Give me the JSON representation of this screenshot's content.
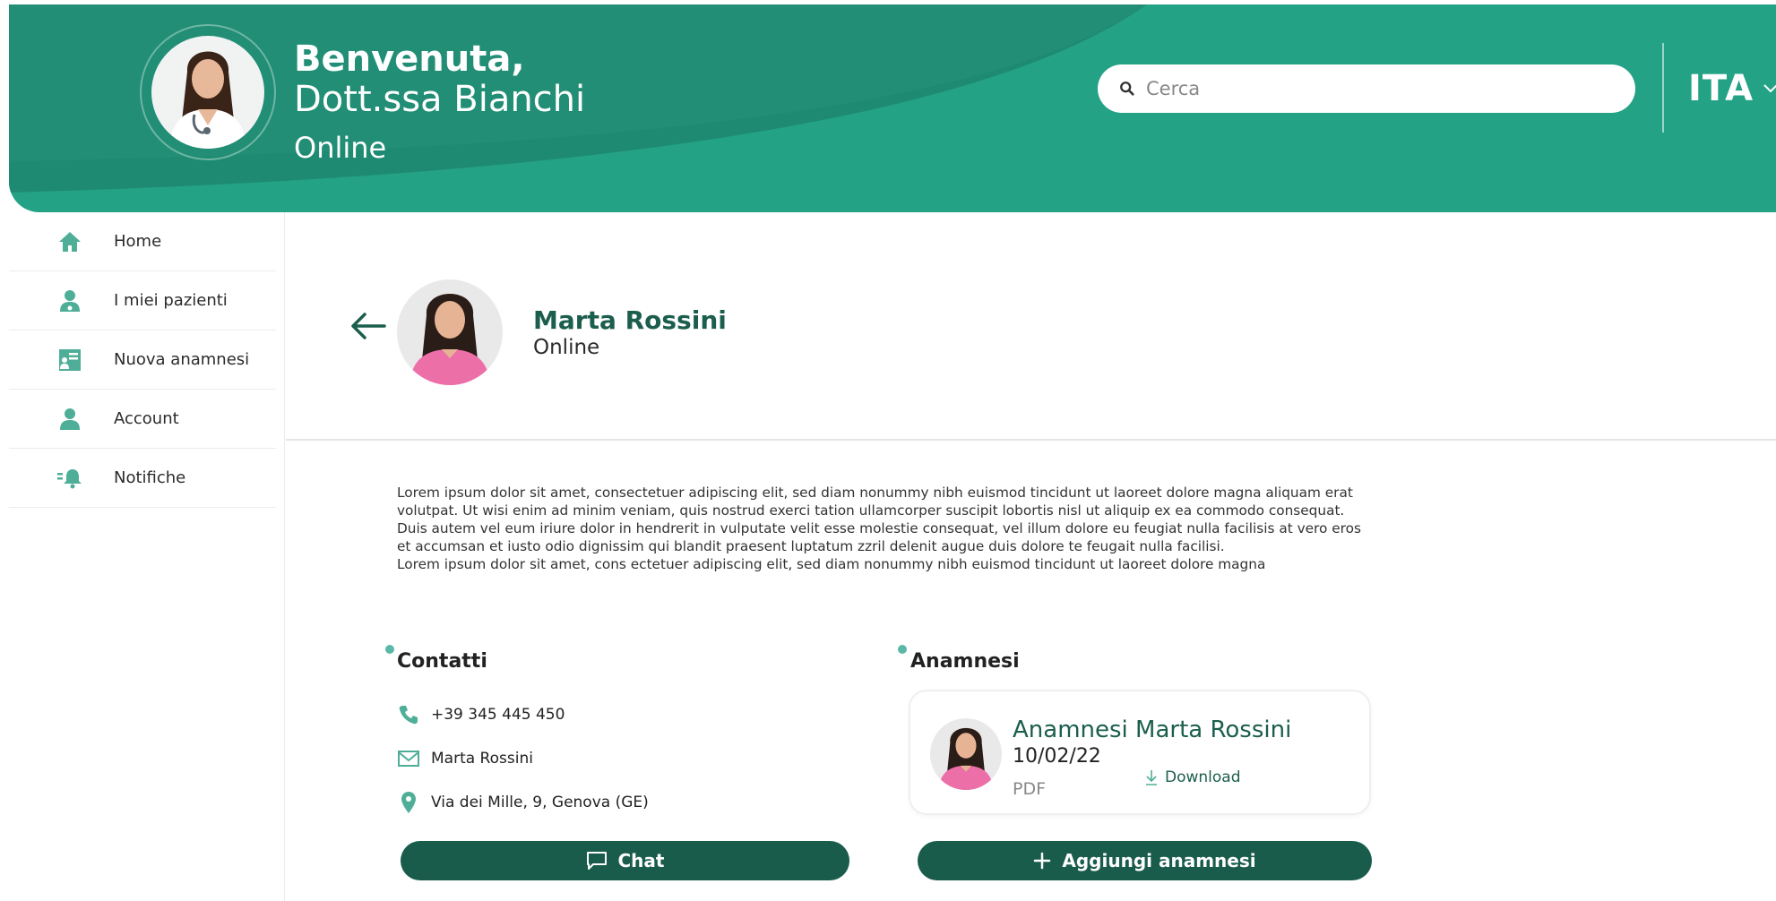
{
  "header": {
    "greeting_line1": "Benvenuta,",
    "greeting_line2": "Dott.ssa Bianchi",
    "status": "Online",
    "search_placeholder": "Cerca",
    "language": "ITA"
  },
  "sidebar": {
    "items": [
      {
        "label": "Home",
        "icon": "home-icon"
      },
      {
        "label": "I miei pazienti",
        "icon": "patients-icon"
      },
      {
        "label": "Nuova anamnesi",
        "icon": "new-anamnesis-icon"
      },
      {
        "label": "Account",
        "icon": "account-icon"
      },
      {
        "label": "Notifiche",
        "icon": "notifications-icon"
      }
    ]
  },
  "patient": {
    "name": "Marta Rossini",
    "status": "Online"
  },
  "description": {
    "paragraph1": "Lorem ipsum dolor sit amet, consectetuer adipiscing elit, sed diam nonummy nibh euismod tincidunt ut laoreet dolore magna aliquam erat volutpat. Ut wisi enim ad minim veniam, quis nostrud exerci tation ullamcorper suscipit lobortis nisl ut aliquip ex ea commodo consequat. Duis autem vel eum iriure dolor in hendrerit in vulputate velit esse molestie consequat, vel illum dolore eu feugiat nulla facilisis at vero eros et accumsan et iusto odio dignissim qui blandit praesent luptatum zzril delenit augue duis dolore te feugait nulla facilisi.",
    "paragraph2": "Lorem ipsum dolor sit amet, cons ectetuer adipiscing elit, sed diam nonummy nibh euismod tincidunt ut laoreet dolore magna"
  },
  "contacts": {
    "title": "Contatti",
    "phone": "+39 345 445 450",
    "email": "Marta Rossini",
    "address": "Via dei Mille, 9, Genova (GE)",
    "chat_button": "Chat"
  },
  "anamnesis": {
    "title": "Anamnesi",
    "card_title": "Anamnesi Marta Rossini",
    "date": "10/02/22",
    "format": "PDF",
    "download_label": "Download",
    "add_button": "Aggiungi anamnesi"
  },
  "colors": {
    "header_teal": "#23a285",
    "header_dark": "#1e7f6a",
    "accent": "#5cb8a6",
    "button": "#195c4b",
    "title_green": "#1c5e4d"
  }
}
